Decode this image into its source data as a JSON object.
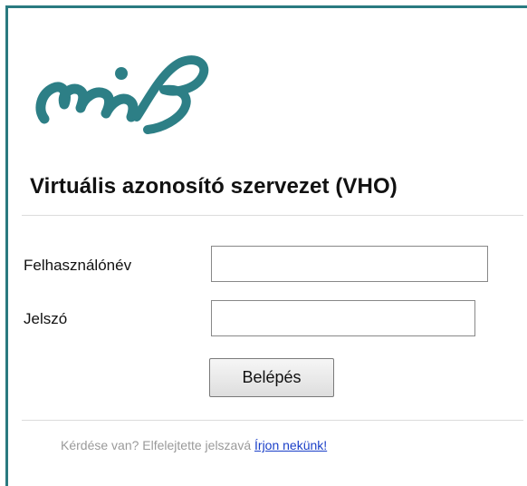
{
  "header": {
    "logo_name": "mif-logo",
    "title": "Virtuális azonosító szervezet (VHO)"
  },
  "form": {
    "username_label": "Felhasználónév",
    "username_value": "",
    "password_label": "Jelszó",
    "password_value": "",
    "submit_label": "Belépés"
  },
  "footer": {
    "help_text": "Kérdése van? Elfelejtette jelszavá ",
    "help_link": "Írjon nekünk!"
  },
  "colors": {
    "accent": "#2a7a80",
    "link": "#1a3fc8"
  }
}
